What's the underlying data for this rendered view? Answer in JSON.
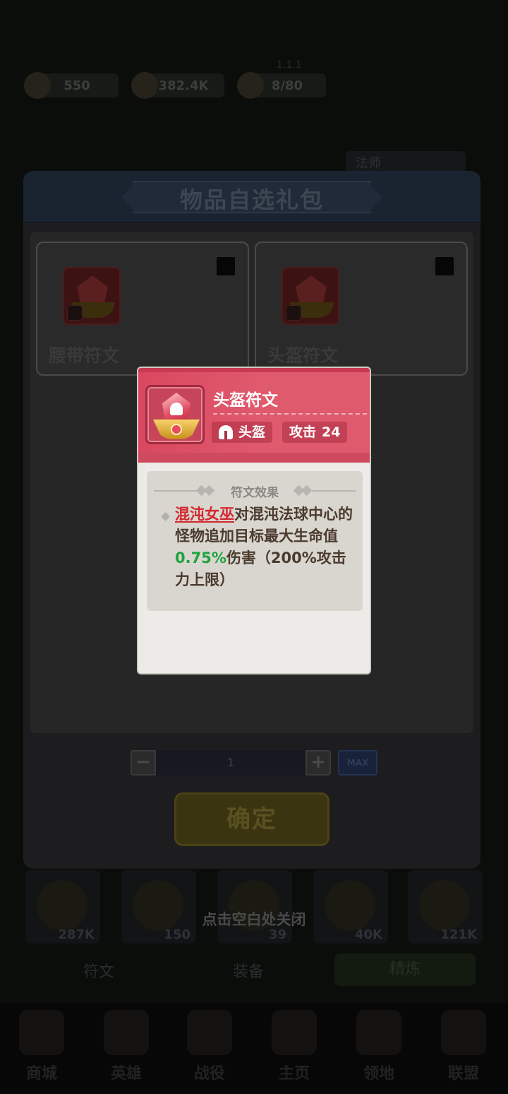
{
  "background": {
    "top_stats": [
      {
        "label": "550"
      },
      {
        "label": "382.4K"
      },
      {
        "label": "8/80"
      }
    ],
    "level_text": "1.1.1",
    "class_tag": "法师",
    "resource_items": [
      {
        "amount": "287K"
      },
      {
        "amount": "150"
      },
      {
        "amount": "39"
      },
      {
        "amount": "40K"
      },
      {
        "amount": "121K"
      }
    ],
    "tabs": {
      "runes": "符文",
      "equipment": "装备",
      "action": "精炼"
    },
    "bottom_nav": [
      {
        "label": "商城"
      },
      {
        "label": "英雄"
      },
      {
        "label": "战役"
      },
      {
        "label": "主页"
      },
      {
        "label": "领地"
      },
      {
        "label": "联盟"
      }
    ]
  },
  "dialog": {
    "title": "物品自选礼包",
    "cards": [
      {
        "name": "腰带符文",
        "checked": false
      },
      {
        "name": "头盔符文",
        "checked": false
      }
    ],
    "quantity": {
      "minus": "−",
      "value": "1",
      "plus": "+",
      "max": "MAX"
    },
    "confirm_label": "确定"
  },
  "close_hint": "点击空白处关闭",
  "tooltip": {
    "title": "头盔符文",
    "slot_label": "头盔",
    "stat_label": "攻击",
    "stat_value": "24",
    "section_title": "符文效果",
    "desc_hero": "混沌女巫",
    "desc_part1": "对混沌法球中心的怪物追加目标最大生命值",
    "desc_percent": "0.75%",
    "desc_part2": "伤害（200%攻击力上限）"
  },
  "colors": {
    "tooltip_header": "#d9485e",
    "highlight_red": "#d2282f",
    "highlight_green": "#1ea43c"
  }
}
